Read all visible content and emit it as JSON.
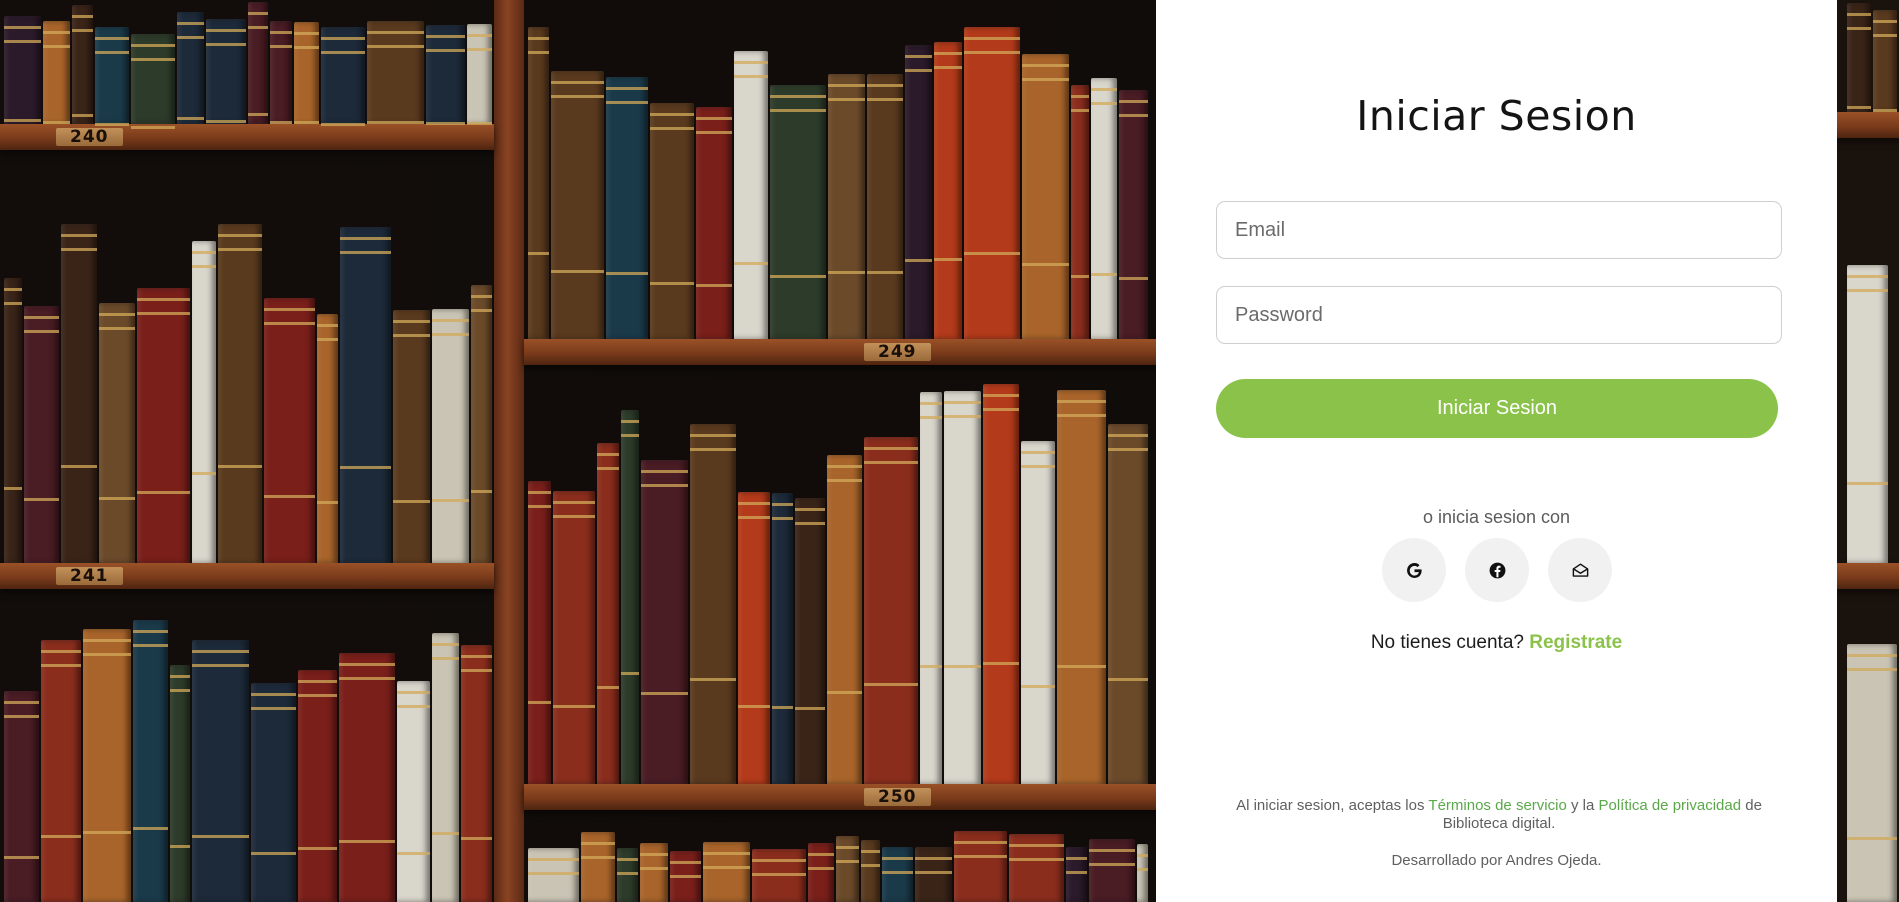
{
  "background": {
    "shelf_numbers": [
      "240",
      "249",
      "241",
      "250"
    ]
  },
  "login": {
    "title": "Iniciar Sesion",
    "email_placeholder": "Email",
    "password_placeholder": "Password",
    "submit_label": "Iniciar Sesion",
    "alt_text": "o inicia sesion con",
    "social": [
      {
        "icon": "google-icon"
      },
      {
        "icon": "facebook-icon"
      },
      {
        "icon": "mail-icon"
      }
    ],
    "register_prompt": "No tienes cuenta?",
    "register_link": "Registrate",
    "legal_prefix": "Al iniciar sesion, aceptas los",
    "terms_link": "Términos de servicio",
    "legal_middle": "y la",
    "privacy_link": "Política de privacidad",
    "legal_suffix": "de Biblioteca digital.",
    "credit": "Desarrollado por Andres Ojeda."
  },
  "colors": {
    "accent": "#8bc34a",
    "panel_bg": "#ffffff",
    "title": "#141414"
  }
}
